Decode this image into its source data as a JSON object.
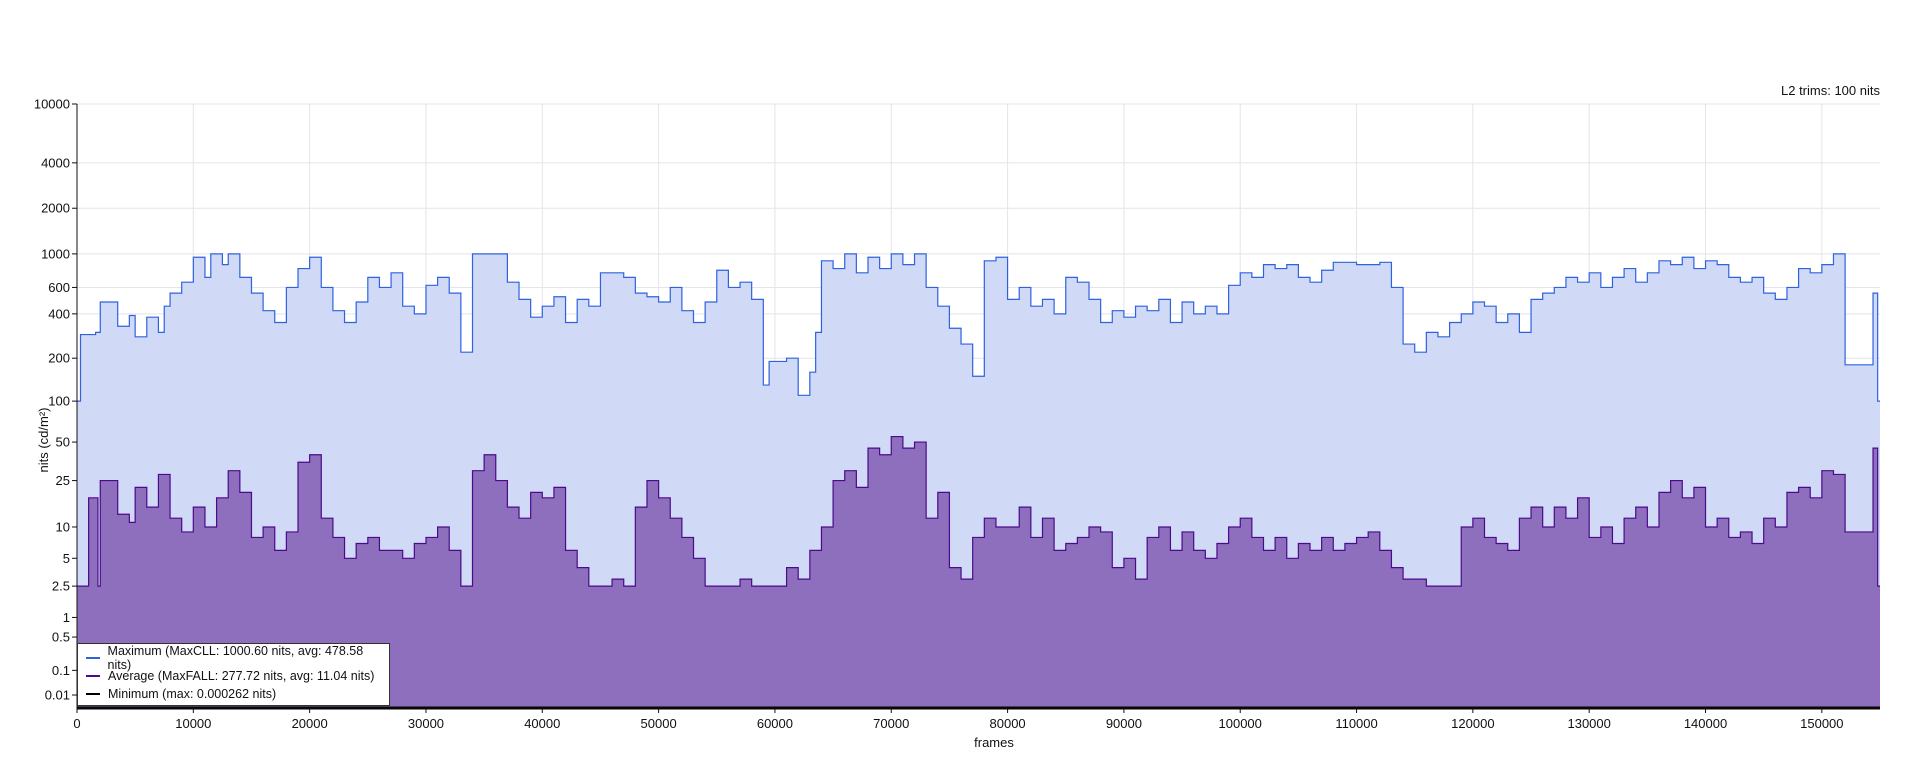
{
  "chart_data": {
    "type": "area",
    "title": "",
    "annotation": "L2 trims: 100 nits",
    "xlabel": "frames",
    "ylabel": "nits (cd/m²)",
    "y_scale": "pq",
    "xlim": [
      0,
      155000
    ],
    "ylim": [
      0,
      10000
    ],
    "grid": true,
    "legend_position": "bottom-left",
    "x_ticks": [
      0,
      10000,
      20000,
      30000,
      40000,
      50000,
      60000,
      70000,
      80000,
      90000,
      100000,
      110000,
      120000,
      130000,
      140000,
      150000
    ],
    "y_ticks": [
      0.01,
      0.1,
      0.5,
      1,
      2.5,
      5,
      10,
      25,
      50,
      100,
      200,
      400,
      600,
      1000,
      2000,
      4000,
      10000
    ],
    "series": [
      {
        "name": "Maximum",
        "legend": "Maximum (MaxCLL: 1000.60 nits, avg: 478.58 nits)",
        "line_color": "#2f62e0",
        "fill_color": "#d0d9f5",
        "steps": [
          [
            0,
            100
          ],
          [
            300,
            290
          ],
          [
            1600,
            300
          ],
          [
            2000,
            480
          ],
          [
            3500,
            330
          ],
          [
            4500,
            390
          ],
          [
            5000,
            280
          ],
          [
            6000,
            380
          ],
          [
            7000,
            300
          ],
          [
            7500,
            450
          ],
          [
            8000,
            550
          ],
          [
            9000,
            650
          ],
          [
            10000,
            950
          ],
          [
            11000,
            700
          ],
          [
            11500,
            1000
          ],
          [
            12500,
            850
          ],
          [
            13000,
            1000
          ],
          [
            14000,
            700
          ],
          [
            15000,
            550
          ],
          [
            16000,
            420
          ],
          [
            17000,
            350
          ],
          [
            18000,
            600
          ],
          [
            19000,
            800
          ],
          [
            20000,
            950
          ],
          [
            21000,
            600
          ],
          [
            22000,
            420
          ],
          [
            23000,
            350
          ],
          [
            24000,
            480
          ],
          [
            25000,
            700
          ],
          [
            26000,
            600
          ],
          [
            27000,
            750
          ],
          [
            28000,
            450
          ],
          [
            29000,
            400
          ],
          [
            30000,
            620
          ],
          [
            31000,
            700
          ],
          [
            32000,
            550
          ],
          [
            33000,
            220
          ],
          [
            34000,
            1000
          ],
          [
            37000,
            650
          ],
          [
            38000,
            500
          ],
          [
            39000,
            380
          ],
          [
            40000,
            450
          ],
          [
            41000,
            520
          ],
          [
            42000,
            350
          ],
          [
            43000,
            500
          ],
          [
            44000,
            450
          ],
          [
            45000,
            750
          ],
          [
            47000,
            700
          ],
          [
            48000,
            550
          ],
          [
            49000,
            520
          ],
          [
            50000,
            480
          ],
          [
            51000,
            600
          ],
          [
            52000,
            420
          ],
          [
            53000,
            350
          ],
          [
            54000,
            480
          ],
          [
            55000,
            780
          ],
          [
            56000,
            600
          ],
          [
            57000,
            650
          ],
          [
            58000,
            500
          ],
          [
            59000,
            130
          ],
          [
            59500,
            190
          ],
          [
            61000,
            200
          ],
          [
            62000,
            110
          ],
          [
            63000,
            160
          ],
          [
            63500,
            300
          ],
          [
            64000,
            900
          ],
          [
            65000,
            800
          ],
          [
            66000,
            1000
          ],
          [
            67000,
            750
          ],
          [
            68000,
            950
          ],
          [
            69000,
            800
          ],
          [
            70000,
            1000
          ],
          [
            71000,
            850
          ],
          [
            72000,
            1000
          ],
          [
            73000,
            600
          ],
          [
            74000,
            450
          ],
          [
            75000,
            320
          ],
          [
            76000,
            250
          ],
          [
            77000,
            150
          ],
          [
            78000,
            900
          ],
          [
            79000,
            950
          ],
          [
            80000,
            500
          ],
          [
            81000,
            600
          ],
          [
            82000,
            450
          ],
          [
            83000,
            500
          ],
          [
            84000,
            400
          ],
          [
            85000,
            700
          ],
          [
            86000,
            650
          ],
          [
            87000,
            500
          ],
          [
            88000,
            350
          ],
          [
            89000,
            420
          ],
          [
            90000,
            380
          ],
          [
            91000,
            450
          ],
          [
            92000,
            420
          ],
          [
            93000,
            500
          ],
          [
            94000,
            350
          ],
          [
            95000,
            480
          ],
          [
            96000,
            400
          ],
          [
            97000,
            450
          ],
          [
            98000,
            400
          ],
          [
            99000,
            620
          ],
          [
            100000,
            750
          ],
          [
            101000,
            700
          ],
          [
            102000,
            850
          ],
          [
            103000,
            800
          ],
          [
            104000,
            850
          ],
          [
            105000,
            700
          ],
          [
            106000,
            650
          ],
          [
            107000,
            780
          ],
          [
            108000,
            880
          ],
          [
            110000,
            850
          ],
          [
            112000,
            880
          ],
          [
            113000,
            600
          ],
          [
            114000,
            250
          ],
          [
            115000,
            220
          ],
          [
            116000,
            300
          ],
          [
            117000,
            280
          ],
          [
            118000,
            350
          ],
          [
            119000,
            400
          ],
          [
            120000,
            480
          ],
          [
            121000,
            450
          ],
          [
            122000,
            350
          ],
          [
            123000,
            400
          ],
          [
            124000,
            300
          ],
          [
            125000,
            500
          ],
          [
            126000,
            550
          ],
          [
            127000,
            600
          ],
          [
            128000,
            700
          ],
          [
            129000,
            650
          ],
          [
            130000,
            750
          ],
          [
            131000,
            600
          ],
          [
            132000,
            700
          ],
          [
            133000,
            800
          ],
          [
            134000,
            650
          ],
          [
            135000,
            750
          ],
          [
            136000,
            900
          ],
          [
            137000,
            850
          ],
          [
            138000,
            950
          ],
          [
            139000,
            800
          ],
          [
            140000,
            900
          ],
          [
            141000,
            850
          ],
          [
            142000,
            700
          ],
          [
            143000,
            650
          ],
          [
            144000,
            700
          ],
          [
            145000,
            550
          ],
          [
            146000,
            500
          ],
          [
            147000,
            600
          ],
          [
            148000,
            800
          ],
          [
            149000,
            750
          ],
          [
            150000,
            850
          ],
          [
            151000,
            1000
          ],
          [
            152000,
            180
          ],
          [
            154400,
            550
          ],
          [
            154800,
            100
          ]
        ]
      },
      {
        "name": "Average",
        "legend": "Average (MaxFALL: 277.72 nits, avg: 11.04 nits)",
        "line_color": "#4b0a8c",
        "fill_color": "#8e6fbd",
        "steps": [
          [
            0,
            2.5
          ],
          [
            1000,
            18
          ],
          [
            1800,
            2.5
          ],
          [
            2000,
            25
          ],
          [
            3500,
            13
          ],
          [
            4500,
            11
          ],
          [
            5000,
            22
          ],
          [
            6000,
            15
          ],
          [
            7000,
            28
          ],
          [
            8000,
            12
          ],
          [
            9000,
            9
          ],
          [
            10000,
            15
          ],
          [
            11000,
            10
          ],
          [
            12000,
            18
          ],
          [
            13000,
            30
          ],
          [
            14000,
            20
          ],
          [
            15000,
            8
          ],
          [
            16000,
            10
          ],
          [
            17000,
            6
          ],
          [
            18000,
            9
          ],
          [
            19000,
            35
          ],
          [
            20000,
            40
          ],
          [
            21000,
            12
          ],
          [
            22000,
            8
          ],
          [
            23000,
            5
          ],
          [
            24000,
            7
          ],
          [
            25000,
            8
          ],
          [
            26000,
            6
          ],
          [
            27000,
            6
          ],
          [
            28000,
            5
          ],
          [
            29000,
            7
          ],
          [
            30000,
            8
          ],
          [
            31000,
            10
          ],
          [
            32000,
            6
          ],
          [
            33000,
            2.5
          ],
          [
            34000,
            30
          ],
          [
            35000,
            40
          ],
          [
            36000,
            25
          ],
          [
            37000,
            15
          ],
          [
            38000,
            12
          ],
          [
            39000,
            20
          ],
          [
            40000,
            18
          ],
          [
            41000,
            22
          ],
          [
            42000,
            6
          ],
          [
            43000,
            4
          ],
          [
            44000,
            2.5
          ],
          [
            46000,
            3
          ],
          [
            47000,
            2.5
          ],
          [
            48000,
            15
          ],
          [
            49000,
            25
          ],
          [
            50000,
            18
          ],
          [
            51000,
            12
          ],
          [
            52000,
            8
          ],
          [
            53000,
            5
          ],
          [
            54000,
            2.5
          ],
          [
            57000,
            3
          ],
          [
            58000,
            2.5
          ],
          [
            61000,
            4
          ],
          [
            62000,
            3
          ],
          [
            63000,
            6
          ],
          [
            64000,
            10
          ],
          [
            65000,
            25
          ],
          [
            66000,
            30
          ],
          [
            67000,
            22
          ],
          [
            68000,
            45
          ],
          [
            69000,
            40
          ],
          [
            70000,
            55
          ],
          [
            71000,
            45
          ],
          [
            72000,
            50
          ],
          [
            73000,
            12
          ],
          [
            74000,
            20
          ],
          [
            75000,
            4
          ],
          [
            76000,
            3
          ],
          [
            77000,
            8
          ],
          [
            78000,
            12
          ],
          [
            79000,
            10
          ],
          [
            80000,
            10
          ],
          [
            81000,
            15
          ],
          [
            82000,
            8
          ],
          [
            83000,
            12
          ],
          [
            84000,
            6
          ],
          [
            85000,
            7
          ],
          [
            86000,
            8
          ],
          [
            87000,
            10
          ],
          [
            88000,
            9
          ],
          [
            89000,
            4
          ],
          [
            90000,
            5
          ],
          [
            91000,
            3
          ],
          [
            92000,
            8
          ],
          [
            93000,
            10
          ],
          [
            94000,
            6
          ],
          [
            95000,
            9
          ],
          [
            96000,
            6
          ],
          [
            97000,
            5
          ],
          [
            98000,
            7
          ],
          [
            99000,
            10
          ],
          [
            100000,
            12
          ],
          [
            101000,
            8
          ],
          [
            102000,
            6
          ],
          [
            103000,
            8
          ],
          [
            104000,
            5
          ],
          [
            105000,
            7
          ],
          [
            106000,
            6
          ],
          [
            107000,
            8
          ],
          [
            108000,
            6
          ],
          [
            109000,
            7
          ],
          [
            110000,
            8
          ],
          [
            111000,
            9
          ],
          [
            112000,
            6
          ],
          [
            113000,
            4
          ],
          [
            114000,
            3
          ],
          [
            116000,
            2.5
          ],
          [
            119000,
            10
          ],
          [
            120000,
            12
          ],
          [
            121000,
            8
          ],
          [
            122000,
            7
          ],
          [
            123000,
            6
          ],
          [
            124000,
            12
          ],
          [
            125000,
            15
          ],
          [
            126000,
            10
          ],
          [
            127000,
            15
          ],
          [
            128000,
            12
          ],
          [
            129000,
            18
          ],
          [
            130000,
            8
          ],
          [
            131000,
            10
          ],
          [
            132000,
            7
          ],
          [
            133000,
            12
          ],
          [
            134000,
            15
          ],
          [
            135000,
            10
          ],
          [
            136000,
            20
          ],
          [
            137000,
            25
          ],
          [
            138000,
            18
          ],
          [
            139000,
            22
          ],
          [
            140000,
            10
          ],
          [
            141000,
            12
          ],
          [
            142000,
            8
          ],
          [
            143000,
            9
          ],
          [
            144000,
            7
          ],
          [
            145000,
            12
          ],
          [
            146000,
            10
          ],
          [
            147000,
            20
          ],
          [
            148000,
            22
          ],
          [
            149000,
            18
          ],
          [
            150000,
            30
          ],
          [
            151000,
            28
          ],
          [
            152000,
            9
          ],
          [
            154400,
            45
          ],
          [
            154800,
            2.5
          ]
        ]
      },
      {
        "name": "Minimum",
        "legend": "Minimum (max: 0.000262 nits)",
        "line_color": "#000000",
        "fill_color": "none",
        "steps": [
          [
            0,
            0
          ]
        ]
      }
    ]
  }
}
